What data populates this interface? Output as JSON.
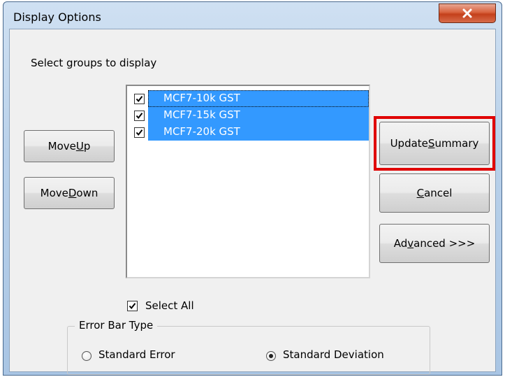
{
  "window": {
    "title": "Display Options",
    "close_glyph": "X"
  },
  "section_label": "Select groups to display",
  "groups": [
    {
      "label": "MCF7-10k GST",
      "checked": true
    },
    {
      "label": "MCF7-15k GST",
      "checked": true
    },
    {
      "label": "MCF7-20k GST",
      "checked": true
    }
  ],
  "buttons": {
    "move_up": {
      "pre": "Move ",
      "key": "U",
      "post": "p"
    },
    "move_down": {
      "pre": "Move ",
      "key": "D",
      "post": "own"
    },
    "update_summary": {
      "pre": "Update ",
      "key": "S",
      "post": "ummary"
    },
    "cancel": {
      "pre": "",
      "key": "C",
      "post": "ancel"
    },
    "advanced": {
      "pre": "Ad",
      "key": "v",
      "post": "anced >>>"
    }
  },
  "select_all": {
    "label": "Select All",
    "checked": true
  },
  "error_bar": {
    "legend": "Error Bar Type",
    "options": [
      {
        "label": "Standard Error",
        "selected": false
      },
      {
        "label": "Standard Deviation",
        "selected": true
      }
    ]
  },
  "colors": {
    "selection": "#3399ff",
    "highlight": "#e00000",
    "close_button": "#c4401b"
  }
}
